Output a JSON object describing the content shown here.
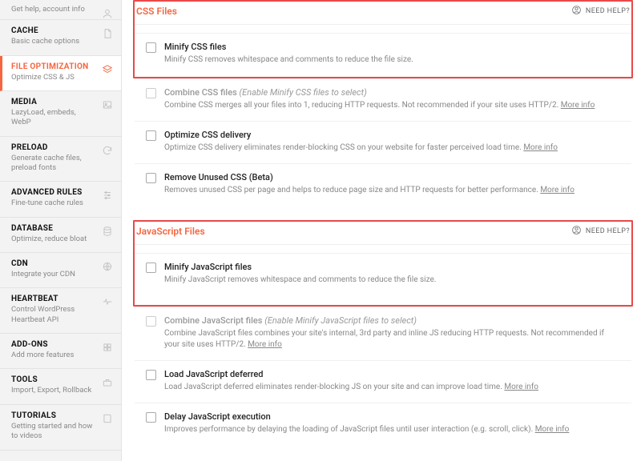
{
  "sidebar": [
    {
      "title": "Get help, account info",
      "sub": ""
    },
    {
      "title": "CACHE",
      "sub": "Basic cache options"
    },
    {
      "title": "FILE OPTIMIZATION",
      "sub": "Optimize CSS & JS"
    },
    {
      "title": "MEDIA",
      "sub": "LazyLoad, embeds, WebP"
    },
    {
      "title": "PRELOAD",
      "sub": "Generate cache files, preload fonts"
    },
    {
      "title": "ADVANCED RULES",
      "sub": "Fine-tune cache rules"
    },
    {
      "title": "DATABASE",
      "sub": "Optimize, reduce bloat"
    },
    {
      "title": "CDN",
      "sub": "Integrate your CDN"
    },
    {
      "title": "HEARTBEAT",
      "sub": "Control WordPress Heartbeat API"
    },
    {
      "title": "ADD-ONS",
      "sub": "Add more features"
    },
    {
      "title": "TOOLS",
      "sub": "Import, Export, Rollback"
    },
    {
      "title": "TUTORIALS",
      "sub": "Getting started and how to videos"
    }
  ],
  "needHelp": "NEED HELP?",
  "moreInfo": "More info",
  "sections": {
    "css": {
      "title": "CSS Files",
      "items": [
        {
          "title": "Minify CSS files",
          "hint": "",
          "desc": "Minify CSS removes whitespace and comments to reduce the file size.",
          "more": false,
          "dim": false
        },
        {
          "title": "Combine CSS files",
          "hint": "(Enable Minify CSS files to select)",
          "desc": "Combine CSS merges all your files into 1, reducing HTTP requests. Not recommended if your site uses HTTP/2.",
          "more": true,
          "dim": true
        },
        {
          "title": "Optimize CSS delivery",
          "hint": "",
          "desc": "Optimize CSS delivery eliminates render-blocking CSS on your website for faster perceived load time.",
          "more": true,
          "dim": false
        },
        {
          "title": "Remove Unused CSS (Beta)",
          "hint": "",
          "desc": "Removes unused CSS per page and helps to reduce page size and HTTP requests for better performance.",
          "more": true,
          "dim": false
        }
      ]
    },
    "js": {
      "title": "JavaScript Files",
      "items": [
        {
          "title": "Minify JavaScript files",
          "hint": "",
          "desc": "Minify JavaScript removes whitespace and comments to reduce the file size.",
          "more": false,
          "dim": false
        },
        {
          "title": "Combine JavaScript files",
          "hint": "(Enable Minify JavaScript files to select)",
          "desc": "Combine JavaScript files combines your site's internal, 3rd party and inline JS reducing HTTP requests. Not recommended if your site uses HTTP/2.",
          "more": true,
          "dim": true
        },
        {
          "title": "Load JavaScript deferred",
          "hint": "",
          "desc": "Load JavaScript deferred eliminates render-blocking JS on your site and can improve load time.",
          "more": true,
          "dim": false
        },
        {
          "title": "Delay JavaScript execution",
          "hint": "",
          "desc": "Improves performance by delaying the loading of JavaScript files until user interaction (e.g. scroll, click).",
          "more": true,
          "dim": false
        }
      ]
    }
  }
}
